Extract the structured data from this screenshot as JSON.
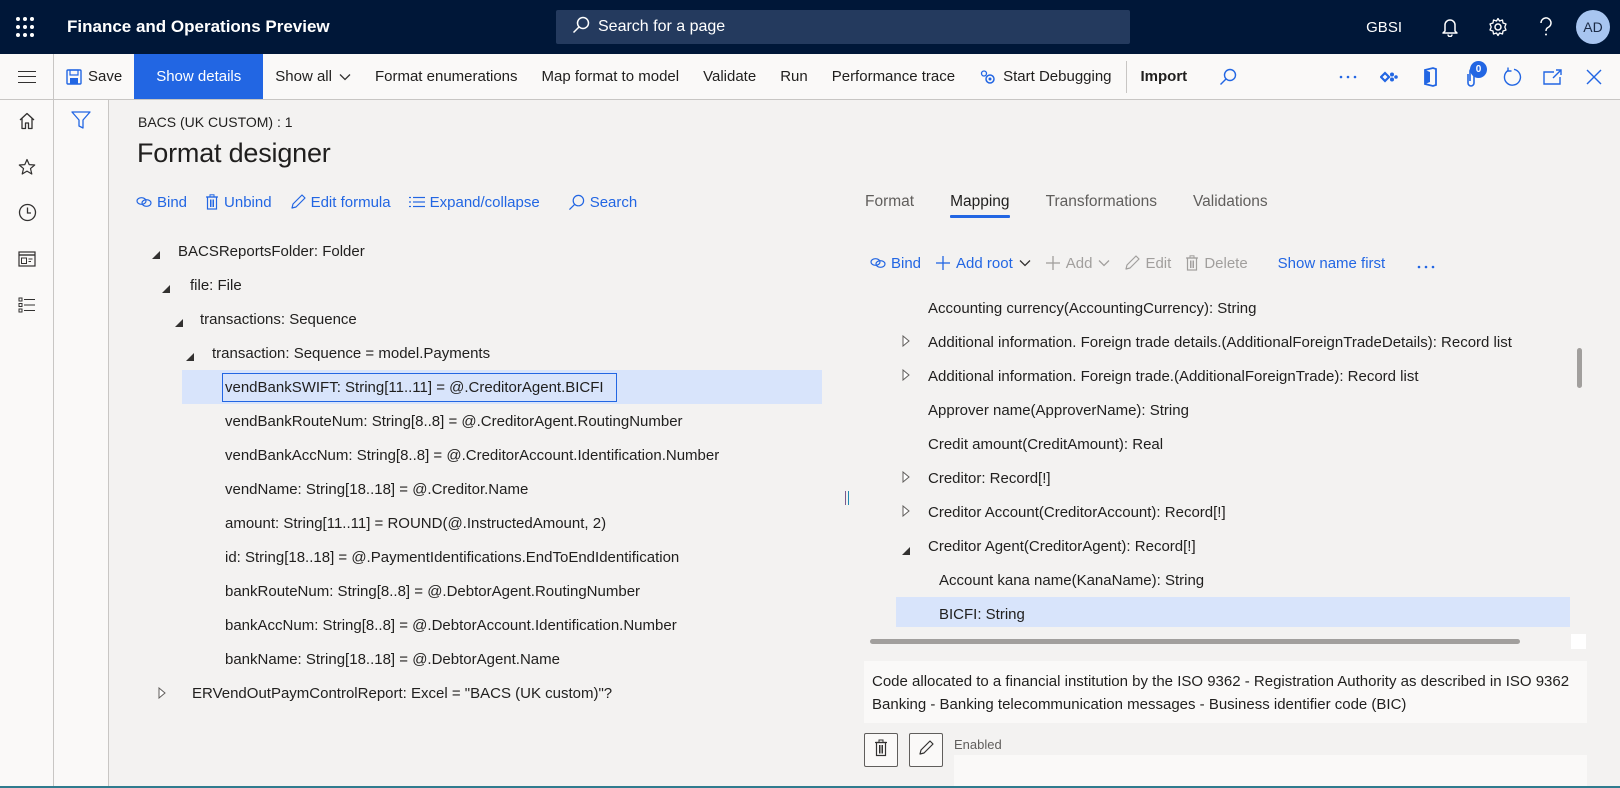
{
  "app": {
    "title": "Finance and Operations Preview",
    "search_placeholder": "Search for a page",
    "company": "GBSI",
    "user_initials": "AD"
  },
  "actionbar": {
    "save": "Save",
    "show_details": "Show details",
    "show_all": "Show all",
    "format_enumerations": "Format enumerations",
    "map_format_to_model": "Map format to model",
    "validate": "Validate",
    "run": "Run",
    "performance_trace": "Performance trace",
    "start_debugging": "Start Debugging",
    "import": "Import",
    "attachments_count": "0"
  },
  "nav": {
    "items": [
      "home",
      "favorites",
      "recent",
      "workspaces",
      "modules"
    ]
  },
  "page": {
    "breadcrumb": "BACS (UK CUSTOM) : 1",
    "title": "Format designer"
  },
  "format_toolbar": {
    "bind": "Bind",
    "unbind": "Unbind",
    "edit_formula": "Edit formula",
    "expand_collapse": "Expand/collapse",
    "search": "Search"
  },
  "format_tree": [
    {
      "label": "BACSReportsFolder: Folder",
      "level": 0,
      "state": "expanded"
    },
    {
      "label": "file: File",
      "level": 1,
      "state": "expanded"
    },
    {
      "label": "transactions: Sequence",
      "level": 2,
      "state": "expanded"
    },
    {
      "label": "transaction: Sequence = model.Payments",
      "level": 3,
      "state": "expanded"
    },
    {
      "label": "vendBankSWIFT: String[11..11] = @.CreditorAgent.BICFI",
      "level": 4,
      "state": "leaf",
      "selected": true
    },
    {
      "label": "vendBankRouteNum: String[8..8] = @.CreditorAgent.RoutingNumber",
      "level": 4,
      "state": "leaf"
    },
    {
      "label": "vendBankAccNum: String[8..8] = @.CreditorAccount.Identification.Number",
      "level": 4,
      "state": "leaf"
    },
    {
      "label": "vendName: String[18..18] = @.Creditor.Name",
      "level": 4,
      "state": "leaf"
    },
    {
      "label": "amount: String[11..11] = ROUND(@.InstructedAmount, 2)",
      "level": 4,
      "state": "leaf"
    },
    {
      "label": "id: String[18..18] = @.PaymentIdentifications.EndToEndIdentification",
      "level": 4,
      "state": "leaf"
    },
    {
      "label": "bankRouteNum: String[8..8] = @.DebtorAgent.RoutingNumber",
      "level": 4,
      "state": "leaf"
    },
    {
      "label": "bankAccNum: String[8..8] = @.DebtorAccount.Identification.Number",
      "level": 4,
      "state": "leaf"
    },
    {
      "label": "bankName: String[18..18] = @.DebtorAgent.Name",
      "level": 4,
      "state": "leaf"
    },
    {
      "label": "ERVendOutPaymControlReport: Excel = \"BACS (UK custom)\"?",
      "level": 1,
      "state": "collapsed"
    }
  ],
  "tabs": [
    {
      "label": "Format",
      "active": false
    },
    {
      "label": "Mapping",
      "active": true
    },
    {
      "label": "Transformations",
      "active": false
    },
    {
      "label": "Validations",
      "active": false
    }
  ],
  "mapping_toolbar": {
    "bind": "Bind",
    "add_root": "Add root",
    "add": "Add",
    "edit": "Edit",
    "delete": "Delete",
    "show_name_first": "Show name first"
  },
  "mapping_tree": [
    {
      "label": "Accounting currency(AccountingCurrency): String",
      "state": "leaf",
      "child": false
    },
    {
      "label": "Additional information. Foreign trade details.(AdditionalForeignTradeDetails): Record list",
      "state": "collapsed",
      "child": false
    },
    {
      "label": "Additional information. Foreign trade.(AdditionalForeignTrade): Record list",
      "state": "collapsed",
      "child": false
    },
    {
      "label": "Approver name(ApproverName): String",
      "state": "leaf",
      "child": false
    },
    {
      "label": "Credit amount(CreditAmount): Real",
      "state": "leaf",
      "child": false
    },
    {
      "label": "Creditor: Record[!]",
      "state": "collapsed",
      "child": false
    },
    {
      "label": "Creditor Account(CreditorAccount): Record[!]",
      "state": "collapsed",
      "child": false
    },
    {
      "label": "Creditor Agent(CreditorAgent): Record[!]",
      "state": "expanded",
      "child": false
    },
    {
      "label": "Account kana name(KanaName): String",
      "state": "leaf",
      "child": true
    },
    {
      "label": "BICFI: String",
      "state": "leaf",
      "child": true,
      "selected": true
    }
  ],
  "details": {
    "description": "Code allocated to a financial institution by the ISO 9362 - Registration Authority as described in ISO 9362 Banking - Banking telecommunication messages - Business identifier code (BIC)",
    "enabled_label": "Enabled",
    "enabled_value": ""
  }
}
